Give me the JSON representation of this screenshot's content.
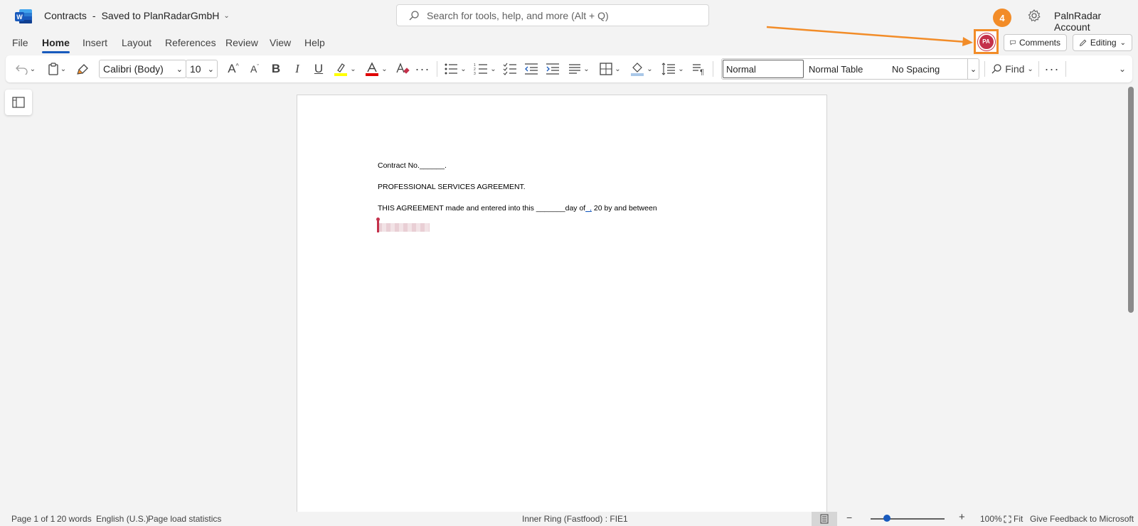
{
  "titlebar": {
    "doc_name": "Contracts",
    "separator": "-",
    "save_status": "Saved to PlanRadarGmbH",
    "search_placeholder": "Search for tools, help, and more (Alt + Q)",
    "account_name": "PalnRadar Account"
  },
  "menu": {
    "tabs": [
      "File",
      "Home",
      "Insert",
      "Layout",
      "References",
      "Review",
      "View",
      "Help"
    ],
    "active_tab": "Home"
  },
  "actions": {
    "avatar_initials": "PA",
    "step_badge": "4",
    "comments_label": "Comments",
    "editing_label": "Editing"
  },
  "ribbon": {
    "font_name": "Calibri (Body)",
    "font_size": "10",
    "styles": {
      "normal": "Normal",
      "normal_table": "Normal Table",
      "no_spacing": "No Spacing"
    },
    "find_label": "Find",
    "highlight_color": "#ffff00",
    "font_color": "#e00000"
  },
  "document": {
    "lines": [
      "Contract No.______.",
      "PROFESSIONAL SERVICES AGREEMENT.",
      "THIS AGREEMENT made and entered into this _______day of",
      "_,",
      " 20 by and between"
    ]
  },
  "statusbar": {
    "page": "Page 1 of 1",
    "words": "20 words",
    "language": "English (U.S.)",
    "load_stats": "Page load statistics",
    "ring": "Inner Ring (Fastfood) : FIE1",
    "zoom": "100%",
    "fit": "Fit",
    "feedback": "Give Feedback to Microsoft"
  },
  "colors": {
    "accent": "#185abd",
    "highlight_box": "#f28c28",
    "avatar": "#c4314b"
  }
}
